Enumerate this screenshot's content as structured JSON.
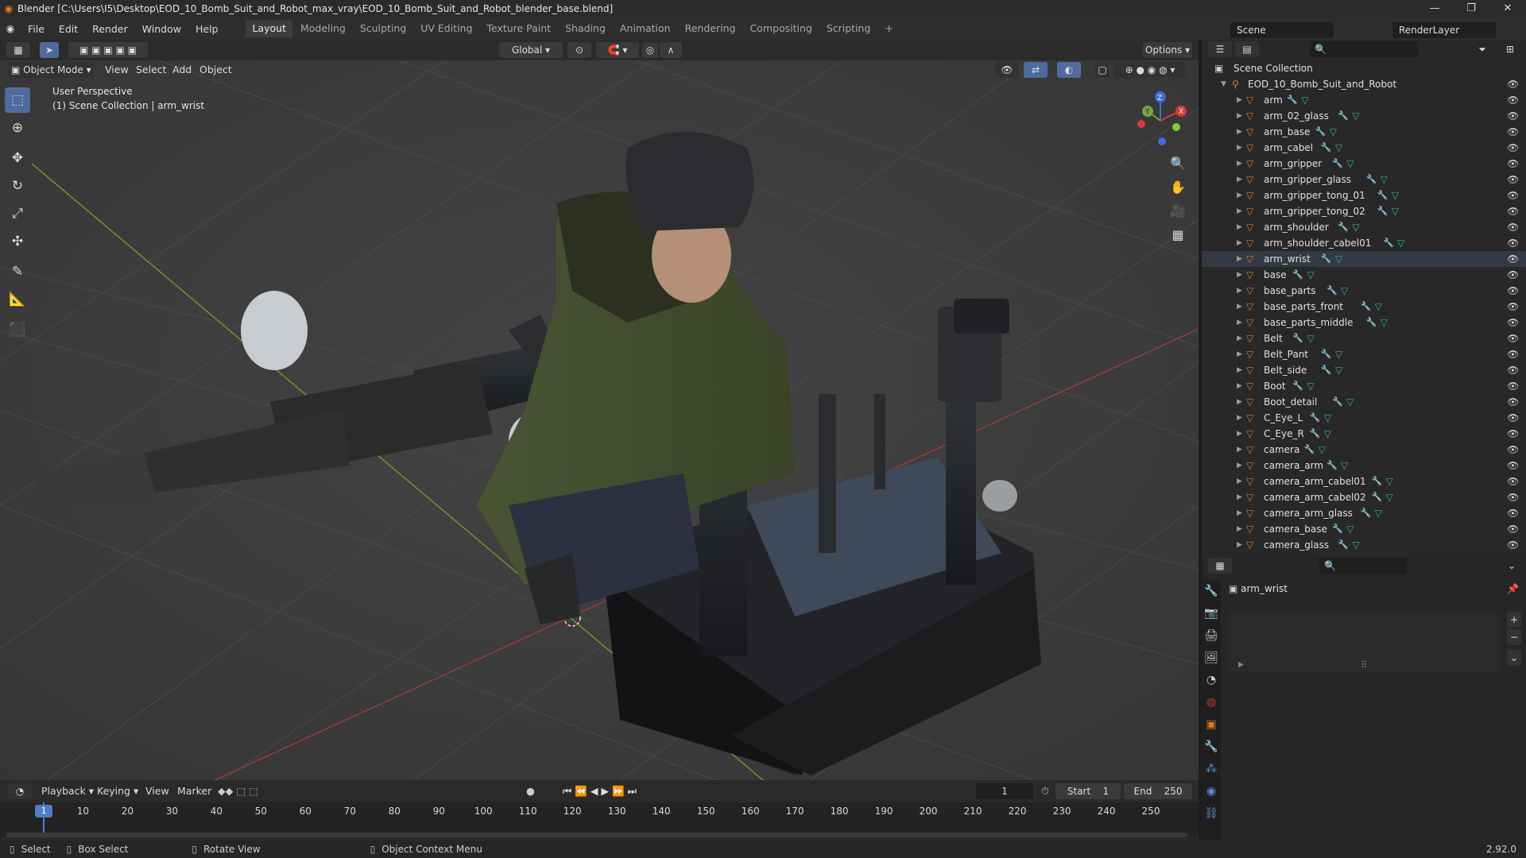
{
  "window": {
    "title": "Blender [C:\\Users\\I5\\Desktop\\EOD_10_Bomb_Suit_and_Robot_max_vray\\EOD_10_Bomb_Suit_and_Robot_blender_base.blend]",
    "minimize": "—",
    "restore": "❐",
    "close": "✕"
  },
  "menu": {
    "items": [
      "File",
      "Edit",
      "Render",
      "Window",
      "Help"
    ],
    "tabs": [
      "Layout",
      "Modeling",
      "Sculpting",
      "UV Editing",
      "Texture Paint",
      "Shading",
      "Animation",
      "Rendering",
      "Compositing",
      "Scripting"
    ],
    "active_tab": "Layout",
    "add_tab": "+",
    "scene_label": "Scene",
    "render_layer_label": "RenderLayer"
  },
  "tool_header": {
    "transform_orientation": "Global",
    "options": "Options"
  },
  "viewport_header": {
    "mode": "Object Mode",
    "menus": [
      "View",
      "Select",
      "Add",
      "Object"
    ]
  },
  "viewport": {
    "perspective_label": "User Perspective",
    "collection_label": "(1) Scene Collection | arm_wrist",
    "gizmo": {
      "x": "X",
      "y": "Y",
      "z": "Z"
    }
  },
  "outliner": {
    "root": "Scene Collection",
    "collection": "EOD_10_Bomb_Suit_and_Robot",
    "objects": [
      "arm",
      "arm_02_glass",
      "arm_base",
      "arm_cabel",
      "arm_gripper",
      "arm_gripper_glass",
      "arm_gripper_tong_01",
      "arm_gripper_tong_02",
      "arm_shoulder",
      "arm_shoulder_cabel01",
      "arm_wrist",
      "base",
      "base_parts",
      "base_parts_front",
      "base_parts_middle",
      "Belt",
      "Belt_Pant",
      "Belt_side",
      "Boot",
      "Boot_detail",
      "C_Eye_L",
      "C_Eye_R",
      "camera",
      "camera_arm",
      "camera_arm_cabel01",
      "camera_arm_cabel02",
      "camera_arm_glass",
      "camera_base",
      "camera_glass"
    ]
  },
  "properties": {
    "object_name": "arm_wrist",
    "add": "+",
    "remove": "−"
  },
  "timeline": {
    "menus": [
      "Playback",
      "Keying",
      "View",
      "Marker"
    ],
    "current_frame": "1",
    "start_label": "Start",
    "start_value": "1",
    "end_label": "End",
    "end_value": "250",
    "ruler": [
      "10",
      "20",
      "30",
      "40",
      "50",
      "60",
      "70",
      "80",
      "90",
      "100",
      "110",
      "120",
      "130",
      "140",
      "150",
      "160",
      "170",
      "180",
      "190",
      "200",
      "210",
      "220",
      "230",
      "240",
      "250"
    ],
    "playhead": "1"
  },
  "status": {
    "select": "Select",
    "box_select": "Box Select",
    "rotate_view": "Rotate View",
    "context_menu": "Object Context Menu",
    "version": "2.92.0"
  }
}
